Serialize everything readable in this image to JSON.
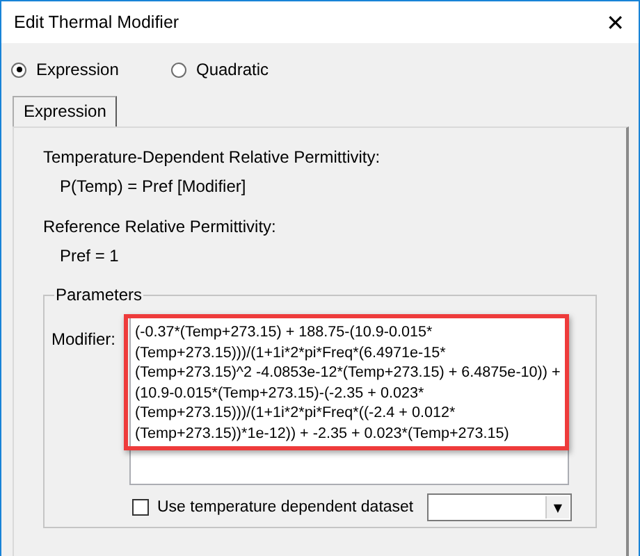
{
  "window": {
    "title": "Edit Thermal Modifier",
    "close": "✕"
  },
  "modes": [
    {
      "label": "Expression",
      "selected": true
    },
    {
      "label": "Quadratic",
      "selected": false
    }
  ],
  "tabs": [
    {
      "label": "Expression",
      "selected": true
    }
  ],
  "formula_heading": "Temperature-Dependent Relative Permittivity:",
  "formula": "P(Temp) = Pref [Modifier]",
  "reference_heading": "Reference Relative Permittivity:",
  "reference": "Pref = 1",
  "parameters": {
    "title": "Parameters",
    "modifier_label": "Modifier:",
    "modifier_value": "(-0.37*(Temp+273.15) + 188.75-(10.9-0.015*(Temp+273.15)))/(1+1i*2*pi*Freq*(6.4971e-15*(Temp+273.15)^2 -4.0853e-12*(Temp+273.15) + 6.4875e-10)) + (10.9-0.015*(Temp+273.15)-(-2.35 + 0.023*(Temp+273.15)))/(1+1i*2*pi*Freq*((-2.4 + 0.012*(Temp+273.15))*1e-12)) + -2.35 + 0.023*(Temp+273.15)",
    "highlighted": true,
    "dataset_checkbox": {
      "label": "Use temperature dependent dataset",
      "checked": false
    },
    "dataset_dropdown": {
      "arrow": "▼"
    }
  }
}
